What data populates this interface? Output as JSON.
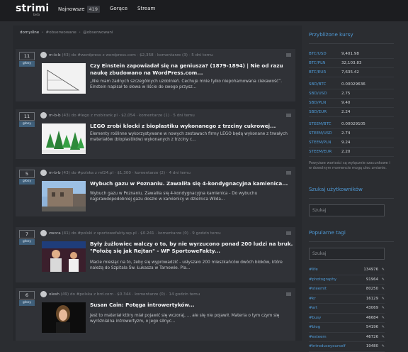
{
  "header": {
    "logo": "strimi",
    "logo_sub": "beta",
    "nav": [
      {
        "label": "Najnowsze",
        "badge": "419"
      },
      {
        "label": "Gorące"
      },
      {
        "label": "Stream"
      }
    ]
  },
  "breadcrumb": [
    "domyślne",
    "#obserwowane",
    "@obserwowani"
  ],
  "posts": [
    {
      "votes": "11",
      "vote_btn": "głosy",
      "author": "m-b-b",
      "points": "(43)",
      "meta_rest": "do #wordpress z wordpress.com · $2,358 · komentarze (3) · 5 dni temu",
      "title": "Czy Einstein zapowiadał się na geniusza?&nbsp;(1879-1894) | Nie od razu naukę zbudowano na WordPress.com...",
      "desc": "„Nie mam żadnych szczególnych uzdolnień. Cechuje mnie tylko niepohamowana ciekawość”. Einstein napisał te słowa w liście do swego przysz..."
    },
    {
      "votes": "11",
      "vote_btn": "głosy",
      "author": "m-b-b",
      "points": "(43)",
      "meta_rest": "do #lego z mobirank.pl · $2,054 · komentarze (1) · 5 dni temu",
      "title": "LEGO zrobi klocki z bioplastiku wykonanego z trzciny cukrowej...",
      "desc": "Elementy roślinne wykorzystywane w nowych zestawach firmy LEGO będą wykonane z trwałych materiałów (bioplastików) wykonanych z trzciny c..."
    },
    {
      "votes": "5",
      "vote_btn": "głosy",
      "author": "m-b-b",
      "points": "(43)",
      "meta_rest": "do #polska z mf24.pl · $1,300 · komentarze (2) · 4 dni temu",
      "title": "Wybuch gazu w Poznaniu. Zawaliła się 4-kondygnacyjna kamienica...",
      "desc": "Wybuch gazu w Poznaniu. Zawaliła się 4-kondygnacyjna kamienica - Do wybuchu najprawdopodobniej gazu doszło w kamienicy w dzielnica Wilda..."
    },
    {
      "votes": "7",
      "vote_btn": "głosy",
      "author": "zwora",
      "points": "(41)",
      "meta_rest": "do #polski z sportowefakty.wp.pl · $0.241 · komentarze (0) · 9 godzin temu",
      "title": "Były żużlowiec walczy o to, by nie wyrzucono ponad 200 ludzi na bruk. \"Położę się jak Rejtan\" - WP SportoweFakty...",
      "desc": "Macie miesiąc na to, żeby się wyprowadzić - usłyszało 200 mieszkańców dwóch bloków, które należą do Szpitala Św. Łukasza w Tarnowie. Pla..."
    },
    {
      "votes": "6",
      "vote_btn": "głosy",
      "author": "olesh",
      "points": "(49)",
      "meta_rest": "do #polska z brd.com · $0.344 · komentarze (0) · 14 godzin temu",
      "title": "Susan Cain: Potęga introwertyków...",
      "desc": "Jest to materiał który miał pojawić się wczoraj, ... ale się nie pojawił. Materia o tym czym się wyróżnialna introwertyzm, o jego silnyc..."
    }
  ],
  "sidebar": {
    "rates_title": "Przybliżone kursy",
    "rates": [
      {
        "k": "BTC/USD",
        "v": "9,401.98"
      },
      {
        "k": "BTC/PLN",
        "v": "32,103.83"
      },
      {
        "k": "BTC/EUR",
        "v": "7,635.42"
      },
      {
        "k": "SBD/BTC",
        "v": "0.00029636"
      },
      {
        "k": "SBD/USD",
        "v": "2.75"
      },
      {
        "k": "SBD/PLN",
        "v": "9.40"
      },
      {
        "k": "SBD/EUR",
        "v": "2.24"
      },
      {
        "k": "STEEM/BTC",
        "v": "0.00029105"
      },
      {
        "k": "STEEM/USD",
        "v": "2.74"
      },
      {
        "k": "STEEM/PLN",
        "v": "9.24"
      },
      {
        "k": "STEEM/EUR",
        "v": "2.20"
      }
    ],
    "rates_note": "Powyższe wartości są wyłącznie szacunkowe i w dowolnym momencie mogą ulec zmianie.",
    "users_title": "Szukaj użytkowników",
    "users_placeholder": "Szukaj",
    "tags_title": "Popularne tagi",
    "tags_placeholder": "Szukaj",
    "tags": [
      {
        "n": "#life",
        "c": "134976"
      },
      {
        "n": "#photography",
        "c": "91964"
      },
      {
        "n": "#steemit",
        "c": "80250"
      },
      {
        "n": "#kr",
        "c": "16129"
      },
      {
        "n": "#art",
        "c": "43069"
      },
      {
        "n": "#busy",
        "c": "46684"
      },
      {
        "n": "#blog",
        "c": "54196"
      },
      {
        "n": "#esteem",
        "c": "46726"
      },
      {
        "n": "#introduceyourself",
        "c": "19480"
      }
    ]
  },
  "colors": {
    "accent": "#4f9ad6",
    "background": "#2b2d31",
    "topbar": "#1c1d20"
  }
}
